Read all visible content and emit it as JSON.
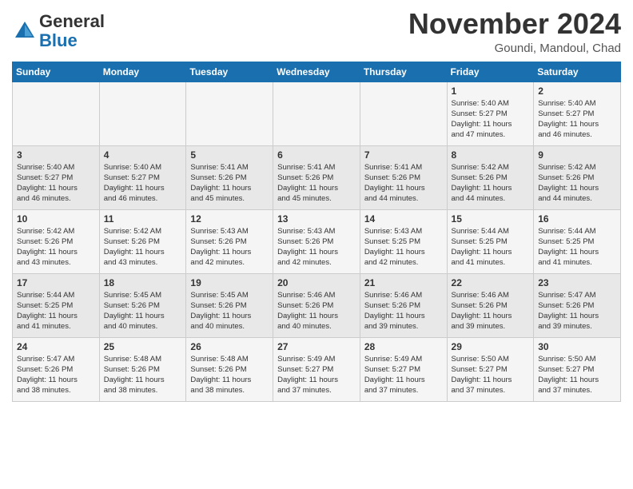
{
  "header": {
    "logo_line1": "General",
    "logo_line2": "Blue",
    "month": "November 2024",
    "location": "Goundi, Mandoul, Chad"
  },
  "weekdays": [
    "Sunday",
    "Monday",
    "Tuesday",
    "Wednesday",
    "Thursday",
    "Friday",
    "Saturday"
  ],
  "weeks": [
    [
      {
        "day": "",
        "info": ""
      },
      {
        "day": "",
        "info": ""
      },
      {
        "day": "",
        "info": ""
      },
      {
        "day": "",
        "info": ""
      },
      {
        "day": "",
        "info": ""
      },
      {
        "day": "1",
        "info": "Sunrise: 5:40 AM\nSunset: 5:27 PM\nDaylight: 11 hours\nand 47 minutes."
      },
      {
        "day": "2",
        "info": "Sunrise: 5:40 AM\nSunset: 5:27 PM\nDaylight: 11 hours\nand 46 minutes."
      }
    ],
    [
      {
        "day": "3",
        "info": "Sunrise: 5:40 AM\nSunset: 5:27 PM\nDaylight: 11 hours\nand 46 minutes."
      },
      {
        "day": "4",
        "info": "Sunrise: 5:40 AM\nSunset: 5:27 PM\nDaylight: 11 hours\nand 46 minutes."
      },
      {
        "day": "5",
        "info": "Sunrise: 5:41 AM\nSunset: 5:26 PM\nDaylight: 11 hours\nand 45 minutes."
      },
      {
        "day": "6",
        "info": "Sunrise: 5:41 AM\nSunset: 5:26 PM\nDaylight: 11 hours\nand 45 minutes."
      },
      {
        "day": "7",
        "info": "Sunrise: 5:41 AM\nSunset: 5:26 PM\nDaylight: 11 hours\nand 44 minutes."
      },
      {
        "day": "8",
        "info": "Sunrise: 5:42 AM\nSunset: 5:26 PM\nDaylight: 11 hours\nand 44 minutes."
      },
      {
        "day": "9",
        "info": "Sunrise: 5:42 AM\nSunset: 5:26 PM\nDaylight: 11 hours\nand 44 minutes."
      }
    ],
    [
      {
        "day": "10",
        "info": "Sunrise: 5:42 AM\nSunset: 5:26 PM\nDaylight: 11 hours\nand 43 minutes."
      },
      {
        "day": "11",
        "info": "Sunrise: 5:42 AM\nSunset: 5:26 PM\nDaylight: 11 hours\nand 43 minutes."
      },
      {
        "day": "12",
        "info": "Sunrise: 5:43 AM\nSunset: 5:26 PM\nDaylight: 11 hours\nand 42 minutes."
      },
      {
        "day": "13",
        "info": "Sunrise: 5:43 AM\nSunset: 5:26 PM\nDaylight: 11 hours\nand 42 minutes."
      },
      {
        "day": "14",
        "info": "Sunrise: 5:43 AM\nSunset: 5:25 PM\nDaylight: 11 hours\nand 42 minutes."
      },
      {
        "day": "15",
        "info": "Sunrise: 5:44 AM\nSunset: 5:25 PM\nDaylight: 11 hours\nand 41 minutes."
      },
      {
        "day": "16",
        "info": "Sunrise: 5:44 AM\nSunset: 5:25 PM\nDaylight: 11 hours\nand 41 minutes."
      }
    ],
    [
      {
        "day": "17",
        "info": "Sunrise: 5:44 AM\nSunset: 5:25 PM\nDaylight: 11 hours\nand 41 minutes."
      },
      {
        "day": "18",
        "info": "Sunrise: 5:45 AM\nSunset: 5:26 PM\nDaylight: 11 hours\nand 40 minutes."
      },
      {
        "day": "19",
        "info": "Sunrise: 5:45 AM\nSunset: 5:26 PM\nDaylight: 11 hours\nand 40 minutes."
      },
      {
        "day": "20",
        "info": "Sunrise: 5:46 AM\nSunset: 5:26 PM\nDaylight: 11 hours\nand 40 minutes."
      },
      {
        "day": "21",
        "info": "Sunrise: 5:46 AM\nSunset: 5:26 PM\nDaylight: 11 hours\nand 39 minutes."
      },
      {
        "day": "22",
        "info": "Sunrise: 5:46 AM\nSunset: 5:26 PM\nDaylight: 11 hours\nand 39 minutes."
      },
      {
        "day": "23",
        "info": "Sunrise: 5:47 AM\nSunset: 5:26 PM\nDaylight: 11 hours\nand 39 minutes."
      }
    ],
    [
      {
        "day": "24",
        "info": "Sunrise: 5:47 AM\nSunset: 5:26 PM\nDaylight: 11 hours\nand 38 minutes."
      },
      {
        "day": "25",
        "info": "Sunrise: 5:48 AM\nSunset: 5:26 PM\nDaylight: 11 hours\nand 38 minutes."
      },
      {
        "day": "26",
        "info": "Sunrise: 5:48 AM\nSunset: 5:26 PM\nDaylight: 11 hours\nand 38 minutes."
      },
      {
        "day": "27",
        "info": "Sunrise: 5:49 AM\nSunset: 5:27 PM\nDaylight: 11 hours\nand 37 minutes."
      },
      {
        "day": "28",
        "info": "Sunrise: 5:49 AM\nSunset: 5:27 PM\nDaylight: 11 hours\nand 37 minutes."
      },
      {
        "day": "29",
        "info": "Sunrise: 5:50 AM\nSunset: 5:27 PM\nDaylight: 11 hours\nand 37 minutes."
      },
      {
        "day": "30",
        "info": "Sunrise: 5:50 AM\nSunset: 5:27 PM\nDaylight: 11 hours\nand 37 minutes."
      }
    ]
  ]
}
